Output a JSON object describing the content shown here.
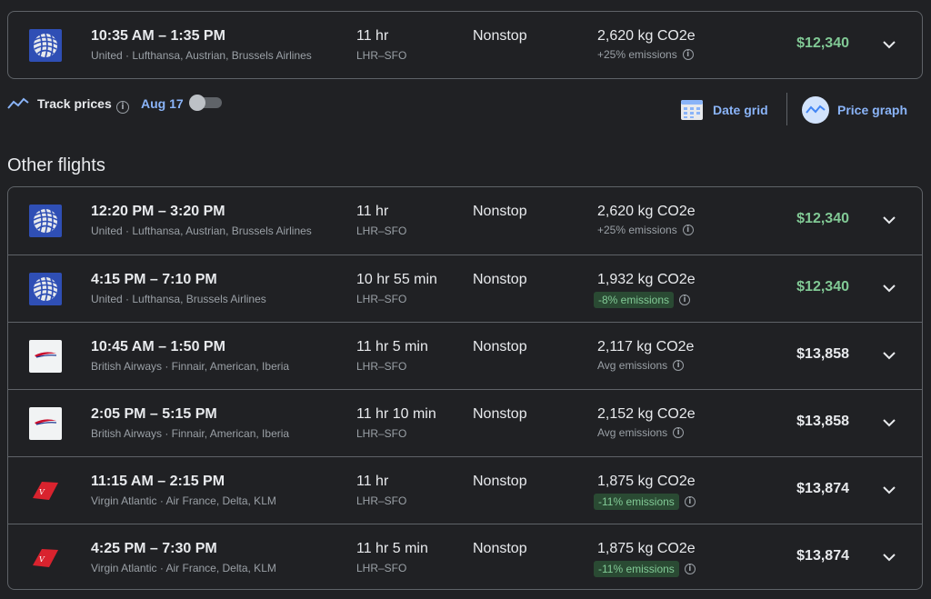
{
  "best_flight": {
    "airline_logo": "united-logo",
    "times": "10:35 AM – 1:35 PM",
    "airlines": "United · Lufthansa, Austrian, Brussels Airlines",
    "duration": "11 hr",
    "route": "LHR–SFO",
    "stops": "Nonstop",
    "co2": "2,620 kg CO2e",
    "emissions": "+25% emissions",
    "emissions_status": "high",
    "price": "$12,340",
    "price_color": "#81c995"
  },
  "tracking": {
    "label": "Track prices",
    "date": "Aug 17",
    "toggle_on": false,
    "date_grid_label": "Date grid",
    "price_graph_label": "Price graph"
  },
  "other_flights": {
    "title": "Other flights",
    "flights": [
      {
        "airline_logo": "united-logo",
        "times": "12:20 PM – 3:20 PM",
        "airlines": "United · Lufthansa, Austrian, Brussels Airlines",
        "duration": "11 hr",
        "route": "LHR–SFO",
        "stops": "Nonstop",
        "co2": "2,620 kg CO2e",
        "emissions": "+25% emissions",
        "emissions_status": "high",
        "price": "$12,340",
        "price_color": "#81c995"
      },
      {
        "airline_logo": "united-logo",
        "times": "4:15 PM – 7:10 PM",
        "airlines": "United · Lufthansa, Brussels Airlines",
        "duration": "10 hr 55 min",
        "route": "LHR–SFO",
        "stops": "Nonstop",
        "co2": "1,932 kg CO2e",
        "emissions": "-8% emissions",
        "emissions_status": "low",
        "price": "$12,340",
        "price_color": "#81c995"
      },
      {
        "airline_logo": "british-airways-logo",
        "times": "10:45 AM – 1:50 PM",
        "airlines": "British Airways · Finnair, American, Iberia",
        "duration": "11 hr 5 min",
        "route": "LHR–SFO",
        "stops": "Nonstop",
        "co2": "2,117 kg CO2e",
        "emissions": "Avg emissions",
        "emissions_status": "avg",
        "price": "$13,858",
        "price_color": "#e8eaed"
      },
      {
        "airline_logo": "british-airways-logo",
        "times": "2:05 PM – 5:15 PM",
        "airlines": "British Airways · Finnair, American, Iberia",
        "duration": "11 hr 10 min",
        "route": "LHR–SFO",
        "stops": "Nonstop",
        "co2": "2,152 kg CO2e",
        "emissions": "Avg emissions",
        "emissions_status": "avg",
        "price": "$13,858",
        "price_color": "#e8eaed"
      },
      {
        "airline_logo": "virgin-atlantic-logo",
        "times": "11:15 AM – 2:15 PM",
        "airlines": "Virgin Atlantic · Air France, Delta, KLM",
        "duration": "11 hr",
        "route": "LHR–SFO",
        "stops": "Nonstop",
        "co2": "1,875 kg CO2e",
        "emissions": "-11% emissions",
        "emissions_status": "low",
        "price": "$13,874",
        "price_color": "#e8eaed"
      },
      {
        "airline_logo": "virgin-atlantic-logo",
        "times": "4:25 PM – 7:30 PM",
        "airlines": "Virgin Atlantic · Air France, Delta, KLM",
        "duration": "11 hr 5 min",
        "route": "LHR–SFO",
        "stops": "Nonstop",
        "co2": "1,875 kg CO2e",
        "emissions": "-11% emissions",
        "emissions_status": "low",
        "price": "$13,874",
        "price_color": "#e8eaed"
      }
    ]
  }
}
